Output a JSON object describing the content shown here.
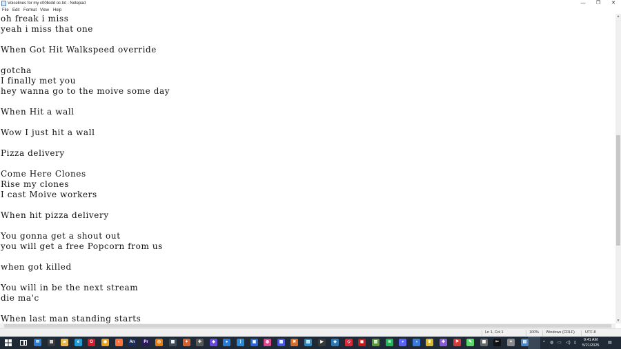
{
  "window": {
    "title": "Voicelines for my c00lkidd oc.txt - Notepad",
    "minimize": "—",
    "maximize": "❐",
    "close": "✕"
  },
  "menu": {
    "file": "File",
    "edit": "Edit",
    "format": "Format",
    "view": "View",
    "help": "Help"
  },
  "document": {
    "lines": [
      "oh freak i miss",
      "yeah i miss that one",
      "",
      "When Got Hit Walkspeed override",
      "",
      "gotcha",
      "I finally met you",
      "hey wanna go to the moive some day",
      "",
      "When Hit a wall",
      "",
      "Wow I just hit a wall",
      "",
      "Pizza delivery",
      "",
      "Come Here Clones",
      "Rise my clones",
      "I cast Moive workers",
      "",
      "When hit pizza delivery",
      "",
      "You gonna get a shout out",
      "you will get a free Popcorn from us",
      "",
      "when got killed",
      "",
      "You will in be the next stream",
      "die ma'c",
      "",
      "When last man standing starts"
    ]
  },
  "status": {
    "position": "Ln 1, Col 1",
    "zoom": "100%",
    "line_ending": "Windows (CRLF)",
    "encoding": "UTF-8"
  },
  "taskbar": {
    "apps": [
      {
        "name": "mail-icon",
        "color": "#2b7cd3",
        "glyph": "✉"
      },
      {
        "name": "store-icon",
        "color": "#3a3a3a",
        "glyph": "▤"
      },
      {
        "name": "file-explorer-icon",
        "color": "#e8b84a",
        "glyph": "▰"
      },
      {
        "name": "edge-icon",
        "color": "#1f9bd6",
        "glyph": "e"
      },
      {
        "name": "opera-icon",
        "color": "#d01c2b",
        "glyph": "O"
      },
      {
        "name": "chrome-icon",
        "color": "#e8a21c",
        "glyph": "◉"
      },
      {
        "name": "firefox-icon",
        "color": "#ff7139",
        "glyph": "◐"
      },
      {
        "name": "animate-icon",
        "color": "#1a2c5a",
        "glyph": "An"
      },
      {
        "name": "premiere-icon",
        "color": "#2a1a5a",
        "glyph": "Pr"
      },
      {
        "name": "blender-icon",
        "color": "#e87d0d",
        "glyph": "◎"
      },
      {
        "name": "notes-icon",
        "color": "#444c58",
        "glyph": "▦"
      },
      {
        "name": "paint-icon",
        "color": "#d8602a",
        "glyph": "✦"
      },
      {
        "name": "game-icon",
        "color": "#5a5a5a",
        "glyph": "✚"
      },
      {
        "name": "browser-icon",
        "color": "#6a4ad8",
        "glyph": "◆"
      },
      {
        "name": "droplet-icon",
        "color": "#2a7ad8",
        "glyph": "●"
      },
      {
        "name": "vscode-icon",
        "color": "#2a8ad8",
        "glyph": "⟩"
      },
      {
        "name": "remote-icon",
        "color": "#2a6ad8",
        "glyph": "▣"
      },
      {
        "name": "discord-app-icon",
        "color": "#d84a8a",
        "glyph": "◍"
      },
      {
        "name": "launcher-icon",
        "color": "#4a5ad8",
        "glyph": "▩"
      },
      {
        "name": "tools-icon",
        "color": "#d86a2a",
        "glyph": "✖"
      },
      {
        "name": "image-viewer-icon",
        "color": "#2a8ac8",
        "glyph": "▨"
      },
      {
        "name": "media-player-icon",
        "color": "#3a3a3a",
        "glyph": "▶"
      },
      {
        "name": "puzzle-icon",
        "color": "#2a7ab8",
        "glyph": "◈"
      },
      {
        "name": "roblox-icon",
        "color": "#d82a3a",
        "glyph": "◇"
      },
      {
        "name": "app-red-icon",
        "color": "#c81a1a",
        "glyph": "◼"
      },
      {
        "name": "minecraft-icon",
        "color": "#5a9a3a",
        "glyph": "▥"
      },
      {
        "name": "spotify-icon",
        "color": "#1db954",
        "glyph": "≋"
      },
      {
        "name": "discord-icon",
        "color": "#5865f2",
        "glyph": "◕"
      },
      {
        "name": "shield-icon",
        "color": "#3a7ad8",
        "glyph": "◑"
      },
      {
        "name": "trophy-icon",
        "color": "#d8b82a",
        "glyph": "♛"
      },
      {
        "name": "puzzle-pieces-icon",
        "color": "#8a5ad8",
        "glyph": "✤"
      },
      {
        "name": "flag-icon",
        "color": "#d83a3a",
        "glyph": "⚑"
      },
      {
        "name": "brush-icon",
        "color": "#5ad86a",
        "glyph": "✎"
      },
      {
        "name": "gallery-icon",
        "color": "#6a6a6a",
        "glyph": "▦"
      },
      {
        "name": "capcut-icon",
        "color": "#111111",
        "glyph": "✂"
      },
      {
        "name": "controller-icon",
        "color": "#8a8a8a",
        "glyph": "⌖"
      },
      {
        "name": "notepad-icon",
        "color": "#4a8ac8",
        "glyph": "▤"
      }
    ],
    "clock": {
      "time": "9:41 AM",
      "date": "5/21/2025"
    }
  }
}
